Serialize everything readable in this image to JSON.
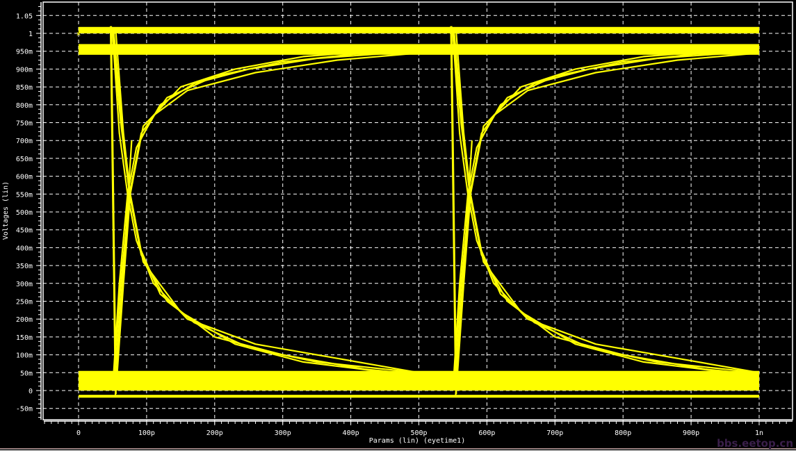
{
  "chart_data": {
    "type": "line",
    "subtype": "eye diagram",
    "xlabel": "Params (lin) (eyetime1)",
    "ylabel": "Voltages (lin)",
    "x_unit": "ps",
    "xlim": [
      0,
      1000
    ],
    "ylim": [
      -0.075,
      1.08
    ],
    "grid": true,
    "trace_color": "#ffff00",
    "background": "#000000",
    "x_ticks": [
      {
        "v": 0,
        "label": "0"
      },
      {
        "v": 100,
        "label": "100p"
      },
      {
        "v": 200,
        "label": "200p"
      },
      {
        "v": 300,
        "label": "300p"
      },
      {
        "v": 400,
        "label": "400p"
      },
      {
        "v": 500,
        "label": "500p"
      },
      {
        "v": 600,
        "label": "600p"
      },
      {
        "v": 700,
        "label": "700p"
      },
      {
        "v": 800,
        "label": "800p"
      },
      {
        "v": 900,
        "label": "900p"
      },
      {
        "v": 1000,
        "label": "1n"
      }
    ],
    "y_ticks": [
      {
        "v": 1.05,
        "label": "1.05"
      },
      {
        "v": 1.0,
        "label": "1"
      },
      {
        "v": 0.95,
        "label": "950m"
      },
      {
        "v": 0.9,
        "label": "900m"
      },
      {
        "v": 0.85,
        "label": "850m"
      },
      {
        "v": 0.8,
        "label": "800m"
      },
      {
        "v": 0.75,
        "label": "750m"
      },
      {
        "v": 0.7,
        "label": "700m"
      },
      {
        "v": 0.65,
        "label": "650m"
      },
      {
        "v": 0.6,
        "label": "600m"
      },
      {
        "v": 0.55,
        "label": "550m"
      },
      {
        "v": 0.5,
        "label": "500m"
      },
      {
        "v": 0.45,
        "label": "450m"
      },
      {
        "v": 0.4,
        "label": "400m"
      },
      {
        "v": 0.35,
        "label": "350m"
      },
      {
        "v": 0.3,
        "label": "300m"
      },
      {
        "v": 0.25,
        "label": "250m"
      },
      {
        "v": 0.2,
        "label": "200m"
      },
      {
        "v": 0.15,
        "label": "150m"
      },
      {
        "v": 0.1,
        "label": "100m"
      },
      {
        "v": 0.05,
        "label": "50m"
      },
      {
        "v": 0,
        "label": "0"
      },
      {
        "v": -0.05,
        "label": "-50m"
      }
    ],
    "bands": [
      {
        "from": 0,
        "to": 1000,
        "y": [
          0.94,
          0.97
        ]
      },
      {
        "from": 0,
        "to": 1000,
        "y": [
          0.0,
          0.055
        ]
      },
      {
        "from": 0,
        "to": 1000,
        "y": [
          1.0,
          1.018
        ]
      },
      {
        "from": 0,
        "to": 1000,
        "y": [
          -0.02,
          -0.012
        ]
      }
    ],
    "series": [
      {
        "points": [
          [
            50,
            0
          ],
          [
            62,
            0.3
          ],
          [
            75,
            0.55
          ],
          [
            90,
            0.7
          ],
          [
            120,
            0.8
          ],
          [
            170,
            0.86
          ],
          [
            250,
            0.9
          ],
          [
            350,
            0.93
          ],
          [
            500,
            0.95
          ]
        ]
      },
      {
        "points": [
          [
            52,
            0
          ],
          [
            65,
            0.32
          ],
          [
            75,
            0.55
          ],
          [
            92,
            0.72
          ],
          [
            130,
            0.82
          ],
          [
            200,
            0.88
          ],
          [
            300,
            0.92
          ],
          [
            420,
            0.945
          ],
          [
            500,
            0.955
          ]
        ]
      },
      {
        "points": [
          [
            55,
            0
          ],
          [
            66,
            0.3
          ],
          [
            76,
            0.55
          ],
          [
            95,
            0.74
          ],
          [
            150,
            0.85
          ],
          [
            230,
            0.9
          ],
          [
            330,
            0.935
          ],
          [
            500,
            0.96
          ]
        ]
      },
      {
        "points": [
          [
            50,
            0
          ],
          [
            60,
            0.3
          ],
          [
            72,
            0.55
          ],
          [
            85,
            0.68
          ],
          [
            110,
            0.77
          ],
          [
            160,
            0.84
          ],
          [
            260,
            0.89
          ],
          [
            380,
            0.925
          ],
          [
            500,
            0.945
          ]
        ]
      },
      {
        "points": [
          [
            50,
            1
          ],
          [
            62,
            0.75
          ],
          [
            75,
            0.55
          ],
          [
            90,
            0.4
          ],
          [
            120,
            0.27
          ],
          [
            170,
            0.19
          ],
          [
            250,
            0.12
          ],
          [
            350,
            0.08
          ],
          [
            500,
            0.05
          ]
        ]
      },
      {
        "points": [
          [
            52,
            1
          ],
          [
            65,
            0.72
          ],
          [
            75,
            0.55
          ],
          [
            92,
            0.38
          ],
          [
            130,
            0.25
          ],
          [
            200,
            0.15
          ],
          [
            300,
            0.1
          ],
          [
            420,
            0.06
          ],
          [
            500,
            0.045
          ]
        ]
      },
      {
        "points": [
          [
            55,
            1
          ],
          [
            66,
            0.72
          ],
          [
            76,
            0.55
          ],
          [
            95,
            0.36
          ],
          [
            150,
            0.22
          ],
          [
            230,
            0.13
          ],
          [
            330,
            0.08
          ],
          [
            500,
            0.04
          ]
        ]
      },
      {
        "points": [
          [
            50,
            1
          ],
          [
            60,
            0.72
          ],
          [
            72,
            0.55
          ],
          [
            85,
            0.42
          ],
          [
            110,
            0.3
          ],
          [
            160,
            0.2
          ],
          [
            260,
            0.13
          ],
          [
            380,
            0.09
          ],
          [
            500,
            0.05
          ]
        ]
      },
      {
        "points": [
          [
            550,
            0
          ],
          [
            562,
            0.3
          ],
          [
            575,
            0.55
          ],
          [
            590,
            0.7
          ],
          [
            620,
            0.8
          ],
          [
            670,
            0.86
          ],
          [
            750,
            0.9
          ],
          [
            850,
            0.93
          ],
          [
            1000,
            0.95
          ]
        ]
      },
      {
        "points": [
          [
            552,
            0
          ],
          [
            565,
            0.32
          ],
          [
            575,
            0.55
          ],
          [
            592,
            0.72
          ],
          [
            630,
            0.82
          ],
          [
            700,
            0.88
          ],
          [
            800,
            0.92
          ],
          [
            920,
            0.945
          ],
          [
            1000,
            0.955
          ]
        ]
      },
      {
        "points": [
          [
            555,
            0
          ],
          [
            566,
            0.3
          ],
          [
            576,
            0.55
          ],
          [
            595,
            0.74
          ],
          [
            650,
            0.85
          ],
          [
            730,
            0.9
          ],
          [
            830,
            0.935
          ],
          [
            1000,
            0.96
          ]
        ]
      },
      {
        "points": [
          [
            550,
            0
          ],
          [
            560,
            0.3
          ],
          [
            572,
            0.55
          ],
          [
            585,
            0.68
          ],
          [
            610,
            0.77
          ],
          [
            660,
            0.84
          ],
          [
            760,
            0.89
          ],
          [
            880,
            0.925
          ],
          [
            1000,
            0.945
          ]
        ]
      },
      {
        "points": [
          [
            550,
            1
          ],
          [
            562,
            0.75
          ],
          [
            575,
            0.55
          ],
          [
            590,
            0.4
          ],
          [
            620,
            0.27
          ],
          [
            670,
            0.19
          ],
          [
            750,
            0.12
          ],
          [
            850,
            0.08
          ],
          [
            1000,
            0.05
          ]
        ]
      },
      {
        "points": [
          [
            552,
            1
          ],
          [
            565,
            0.72
          ],
          [
            575,
            0.55
          ],
          [
            592,
            0.38
          ],
          [
            630,
            0.25
          ],
          [
            700,
            0.15
          ],
          [
            800,
            0.1
          ],
          [
            920,
            0.06
          ],
          [
            1000,
            0.045
          ]
        ]
      },
      {
        "points": [
          [
            555,
            1
          ],
          [
            566,
            0.72
          ],
          [
            576,
            0.55
          ],
          [
            595,
            0.36
          ],
          [
            650,
            0.22
          ],
          [
            730,
            0.13
          ],
          [
            830,
            0.08
          ],
          [
            1000,
            0.04
          ]
        ]
      },
      {
        "points": [
          [
            550,
            1
          ],
          [
            560,
            0.72
          ],
          [
            572,
            0.55
          ],
          [
            585,
            0.42
          ],
          [
            610,
            0.3
          ],
          [
            660,
            0.2
          ],
          [
            760,
            0.13
          ],
          [
            880,
            0.09
          ],
          [
            1000,
            0.05
          ]
        ]
      },
      {
        "points": [
          [
            47,
            1.02
          ],
          [
            54,
            0
          ]
        ]
      },
      {
        "points": [
          [
            48,
            1.02
          ],
          [
            55,
            -0.01
          ]
        ]
      },
      {
        "points": [
          [
            54,
            -0.015
          ],
          [
            73,
            0.55
          ],
          [
            78,
            0.7
          ]
        ]
      },
      {
        "points": [
          [
            547,
            1.02
          ],
          [
            554,
            0
          ]
        ]
      },
      {
        "points": [
          [
            548,
            1.02
          ],
          [
            555,
            -0.01
          ]
        ]
      },
      {
        "points": [
          [
            554,
            -0.015
          ],
          [
            573,
            0.55
          ],
          [
            578,
            0.7
          ]
        ]
      }
    ]
  },
  "watermark": "bbs.eetop.cn"
}
